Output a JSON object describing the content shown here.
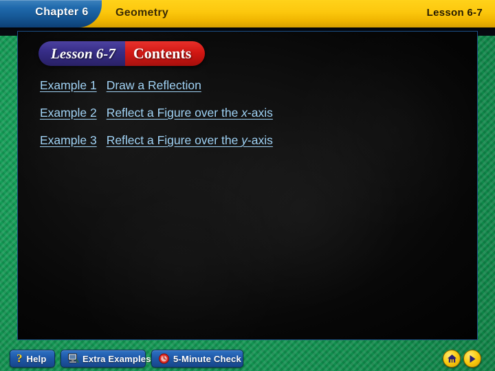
{
  "header": {
    "chapter": "Chapter 6",
    "subject": "Geometry",
    "lesson": "Lesson 6-7"
  },
  "banner": {
    "lesson": "Lesson 6-7",
    "title": "Contents"
  },
  "contents": {
    "items": [
      {
        "number": "Example 1",
        "title_pre": "Draw a Reflection",
        "title_ital": "",
        "title_post": ""
      },
      {
        "number": "Example 2",
        "title_pre": "Reflect a Figure over the ",
        "title_ital": "x",
        "title_post": "-axis"
      },
      {
        "number": "Example 3",
        "title_pre": "Reflect a Figure over the ",
        "title_ital": "y",
        "title_post": "-axis"
      }
    ]
  },
  "toolbar": {
    "help_label": "Help",
    "help_icon": "question-mark-icon",
    "extra_label": "Extra Examples",
    "extra_icon": "computer-monitor-icon",
    "check_label": "5-Minute Check",
    "check_icon": "red-clock-icon",
    "home_icon": "home-icon",
    "next_icon": "play-next-icon"
  },
  "colors": {
    "header_yellow": "#fcc70d",
    "chapter_blue": "#1f69ac",
    "banner_blue": "#342a86",
    "banner_red": "#d21612",
    "link_blue": "#9fd2f5",
    "border_green": "#14a05a",
    "button_blue": "#1f59a8",
    "nav_yellow": "#fbcc10"
  }
}
